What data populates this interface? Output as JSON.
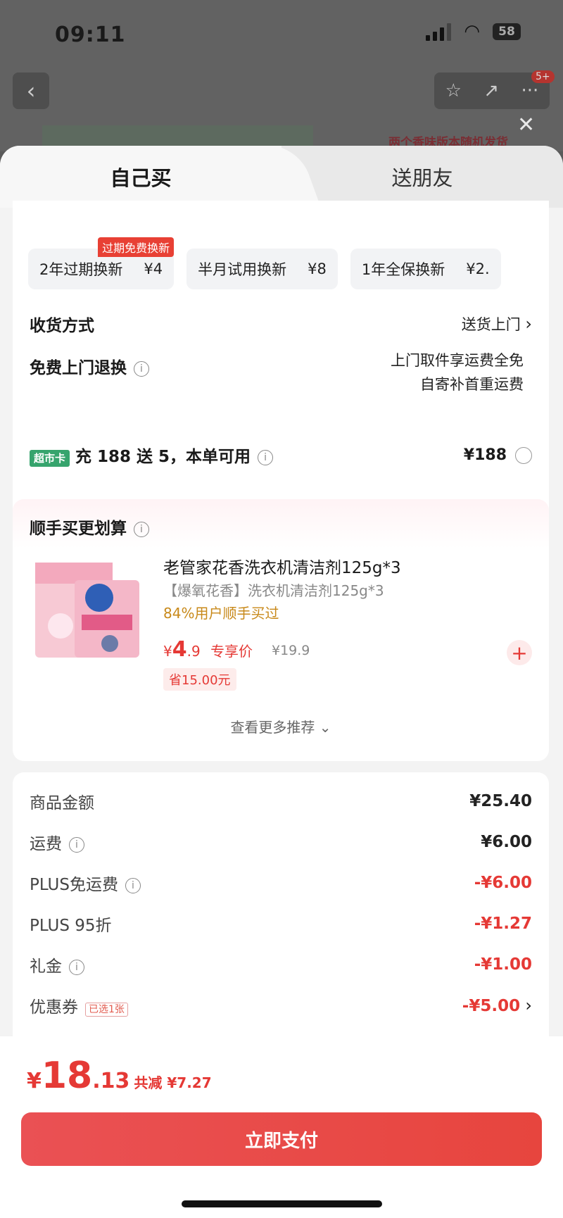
{
  "status_bar": {
    "time": "09:11",
    "battery": "58"
  },
  "nav": {
    "back": "‹",
    "star": "☆",
    "share": "↗",
    "more": "···",
    "cart_badge": "5+"
  },
  "background_promo": "两个香味版本随机发货",
  "tabs": [
    {
      "label": "自己买",
      "active": true
    },
    {
      "label": "送朋友",
      "active": false
    }
  ],
  "services": [
    {
      "name": "2年过期换新",
      "price": "¥4",
      "tag": "过期免费换新"
    },
    {
      "name": "半月试用换新",
      "price": "¥8"
    },
    {
      "name": "1年全保换新",
      "price": "¥2."
    }
  ],
  "delivery": {
    "label": "收货方式",
    "value": "送货上门"
  },
  "free_return": {
    "label": "免费上门退换",
    "line1": "上门取件享运费全免",
    "line2": "自寄补首重运费"
  },
  "market_card": {
    "tag": "超市卡",
    "text": "充 188 送 5，本单可用",
    "price": "¥188"
  },
  "addon": {
    "title": "顺手买更划算",
    "product": {
      "name": "老管家花香洗衣机清洁剂125g*3",
      "subtitle": "【爆氧花香】洗衣机清洁剂125g*3",
      "bought": "84%用户顺手买过",
      "price_symbol": "¥",
      "price_int": "4",
      "price_dec": ".9",
      "price_label": "专享价",
      "original": "¥19.9",
      "save": "省15.00元"
    },
    "more": "查看更多推荐"
  },
  "summary": [
    {
      "label": "商品金额",
      "value": "¥25.40",
      "info": false,
      "red": false
    },
    {
      "label": "运费",
      "value": "¥6.00",
      "info": true,
      "red": false
    },
    {
      "label": "PLUS免运费",
      "value": "-¥6.00",
      "info": true,
      "red": true
    },
    {
      "label": "PLUS 95折",
      "value": "-¥1.27",
      "info": false,
      "red": true
    },
    {
      "label": "礼金",
      "value": "-¥1.00",
      "info": true,
      "red": true
    },
    {
      "label": "优惠券",
      "value": "-¥5.00",
      "info": false,
      "red": true,
      "chip": "已选1张"
    }
  ],
  "footer": {
    "yen": "¥",
    "int": "18",
    "dec": ".13",
    "discount": "共减 ¥7.27",
    "button": "立即支付"
  }
}
